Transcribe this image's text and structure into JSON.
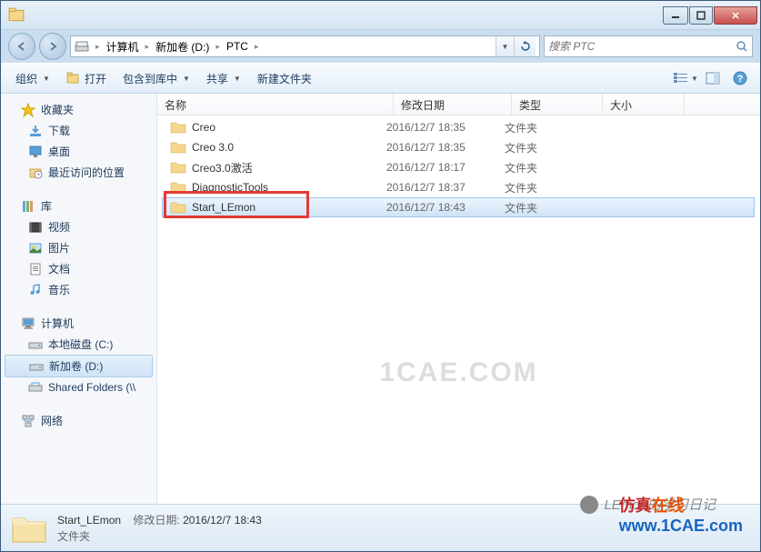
{
  "addressbar": {
    "segments": [
      "计算机",
      "新加卷 (D:)",
      "PTC"
    ]
  },
  "search": {
    "placeholder": "搜索 PTC"
  },
  "toolbar": {
    "organize": "组织",
    "open": "打开",
    "include": "包含到库中",
    "share": "共享",
    "new_folder": "新建文件夹"
  },
  "sidebar": {
    "favorites": {
      "label": "收藏夹",
      "items": [
        "下载",
        "桌面",
        "最近访问的位置"
      ]
    },
    "libraries": {
      "label": "库",
      "items": [
        "视频",
        "图片",
        "文档",
        "音乐"
      ]
    },
    "computer": {
      "label": "计算机",
      "items": [
        "本地磁盘 (C:)",
        "新加卷 (D:)",
        "Shared Folders (\\\\"
      ]
    },
    "network": {
      "label": "网络"
    }
  },
  "columns": {
    "name": "名称",
    "date": "修改日期",
    "type": "类型",
    "size": "大小"
  },
  "files": [
    {
      "name": "Creo",
      "date": "2016/12/7 18:35",
      "type": "文件夹"
    },
    {
      "name": "Creo 3.0",
      "date": "2016/12/7 18:35",
      "type": "文件夹"
    },
    {
      "name": "Creo3.0激活",
      "date": "2016/12/7 18:17",
      "type": "文件夹"
    },
    {
      "name": "DiagnosticTools",
      "date": "2016/12/7 18:37",
      "type": "文件夹"
    },
    {
      "name": "Start_LEmon",
      "date": "2016/12/7 18:43",
      "type": "文件夹"
    }
  ],
  "statusbar": {
    "name": "Start_LEmon",
    "date_label": "修改日期:",
    "date": "2016/12/7 18:43",
    "type": "文件夹"
  },
  "watermark": "1CAE.COM",
  "overlays": {
    "wechat_text": "LEmon的学习日记",
    "site_red": "仿真",
    "site_orange": "在线",
    "site_url": "www.1CAE.com"
  }
}
